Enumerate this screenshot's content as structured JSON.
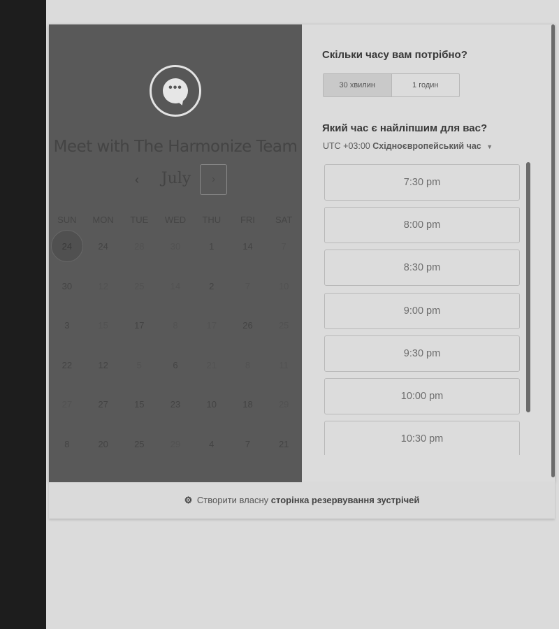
{
  "profile": {
    "title": "Meet with The Harmonize Team",
    "avatar_icon": "chat-bubble-icon",
    "avatar_glyph": "•••"
  },
  "calendar": {
    "month": "July",
    "prev_glyph": "‹",
    "next_glyph": "›",
    "weekdays": [
      "SUN",
      "MON",
      "TUE",
      "WED",
      "THU",
      "FRI",
      "SAT"
    ],
    "weeks": [
      [
        "24",
        "24",
        "28",
        "30",
        "1",
        "14",
        "7"
      ],
      [
        "30",
        "12",
        "25",
        "14",
        "2",
        "7",
        "10"
      ],
      [
        "3",
        "15",
        "17",
        "8",
        "17",
        "26",
        "25"
      ],
      [
        "22",
        "12",
        "5",
        "6",
        "21",
        "8",
        "11"
      ],
      [
        "27",
        "27",
        "15",
        "23",
        "10",
        "18",
        "29"
      ],
      [
        "8",
        "20",
        "25",
        "29",
        "4",
        "7",
        "21"
      ]
    ],
    "selected": "24"
  },
  "booking": {
    "duration_question": "Скільки часу вам потрібно?",
    "durations": [
      "30 хвилин",
      "1 годин"
    ],
    "time_question": "Який час є найліпшим для вас?",
    "timezone_offset": "UTC +03:00",
    "timezone_name": "Східноєвропейський час",
    "slots": [
      "7:30 pm",
      "8:00 pm",
      "8:30 pm",
      "9:00 pm",
      "9:30 pm",
      "10:00 pm",
      "10:30 pm"
    ]
  },
  "footer": {
    "text": "Створити власну",
    "link": "сторінка резервування зустрічей",
    "icon": "sprocket-icon"
  }
}
